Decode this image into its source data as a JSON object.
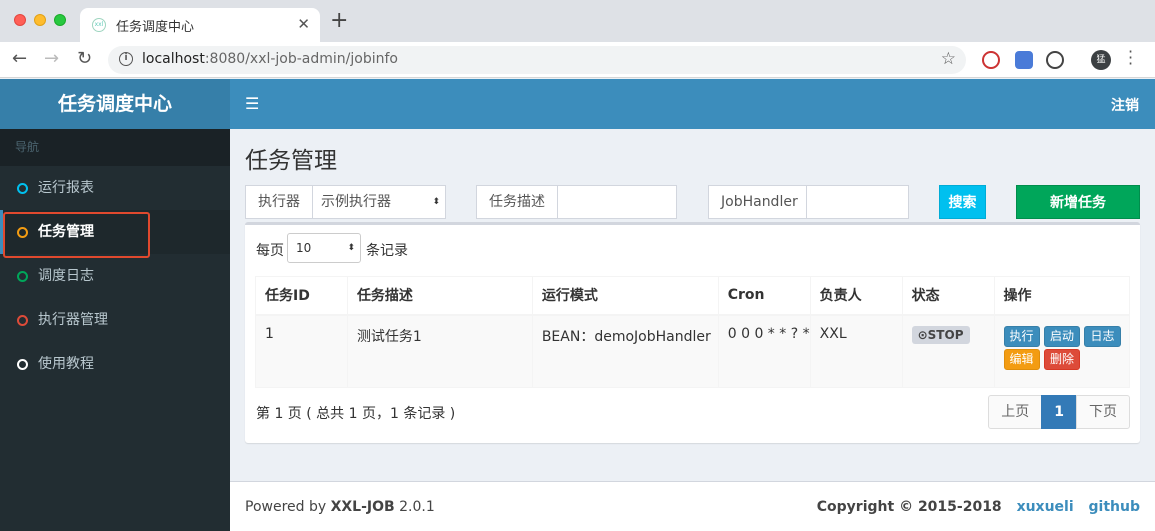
{
  "browser": {
    "tab_title": "任务调度中心",
    "url_host": "localhost",
    "url_rest": ":8080/xxl-job-admin/jobinfo",
    "avatar_text": "猛"
  },
  "colors": {
    "header": "#3c8dbc",
    "sidebar": "#222d32",
    "search": "#00c0ef",
    "add": "#00a65a",
    "highlight": "#e0492e"
  },
  "sidebar": {
    "logo": "任务调度中心",
    "header": "导航",
    "items": [
      {
        "label": "运行报表",
        "color": "#00c0ef"
      },
      {
        "label": "任务管理",
        "color": "#f39c12"
      },
      {
        "label": "调度日志",
        "color": "#00a65a"
      },
      {
        "label": "执行器管理",
        "color": "#dd4b39"
      },
      {
        "label": "使用教程",
        "color": "#ffffff"
      }
    ]
  },
  "topbar": {
    "menu_icon": "hamburger-icon",
    "logout": "注销"
  },
  "main": {
    "title": "任务管理",
    "filters": {
      "executor_label": "执行器",
      "executor_value": "示例执行器",
      "desc_label": "任务描述",
      "handler_label": "JobHandler",
      "search_button": "搜索",
      "add_button": "新增任务"
    },
    "table": {
      "perpage_label": "每页",
      "perpage_value": "10",
      "perpage_suffix": "条记录",
      "headers": [
        "任务ID",
        "任务描述",
        "运行模式",
        "Cron",
        "负责人",
        "状态",
        "操作"
      ],
      "rows": [
        {
          "id": "1",
          "desc": "测试任务1",
          "mode": "BEAN：demoJobHandler",
          "cron": "0 0 0 * * ? *",
          "owner": "XXL",
          "status": "⊙STOP",
          "ops": [
            "执行",
            "启动",
            "日志",
            "编辑",
            "删除"
          ]
        }
      ],
      "page_info": "第 1 页 ( 总共 1 页，1 条记录 )",
      "pager": {
        "prev": "上页",
        "current": "1",
        "next": "下页"
      }
    }
  },
  "footer": {
    "powered_prefix": "Powered by ",
    "powered_brand": "XXL-JOB",
    "powered_version": " 2.0.1",
    "copyright": "Copyright © 2015-2018",
    "author_link": "xuxueli",
    "github_link": "github"
  }
}
